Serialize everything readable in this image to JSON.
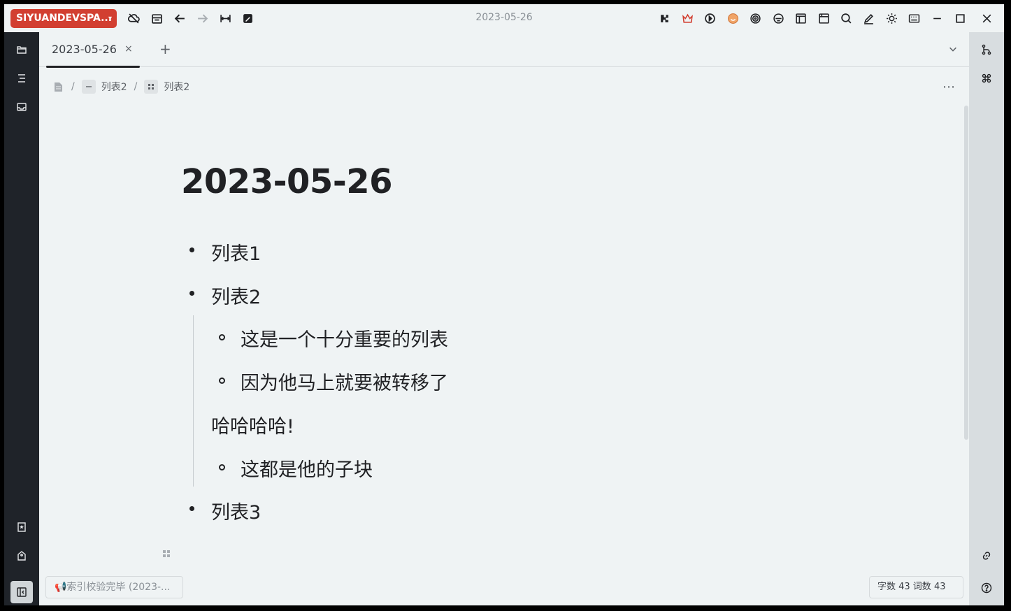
{
  "workspace": {
    "label": "SIYUANDEVSPA..."
  },
  "window": {
    "title": "2023-05-26"
  },
  "tabs": [
    {
      "label": "2023-05-26",
      "close": "×"
    }
  ],
  "tab_add": "+",
  "breadcrumb": [
    {
      "label": "列表2"
    },
    {
      "label": "列表2"
    }
  ],
  "breadcrumb_sep": "/",
  "more": "⋯",
  "document": {
    "title": "2023-05-26",
    "items": [
      {
        "text": "列表1"
      },
      {
        "text": "列表2"
      },
      {
        "text": "这是一个十分重要的列表"
      },
      {
        "text": "因为他马上就要被转移了"
      },
      {
        "text": "哈哈哈哈!"
      },
      {
        "text": "这都是他的子块"
      },
      {
        "text": "列表3"
      }
    ]
  },
  "status": {
    "message": "📢索引校验完毕 (2023-...",
    "counts": "字数 43  词数 43"
  },
  "colors": {
    "workspace_bg": "#d23f31",
    "dock_bg": "#1f2329",
    "editor_bg": "#eff3f4"
  }
}
